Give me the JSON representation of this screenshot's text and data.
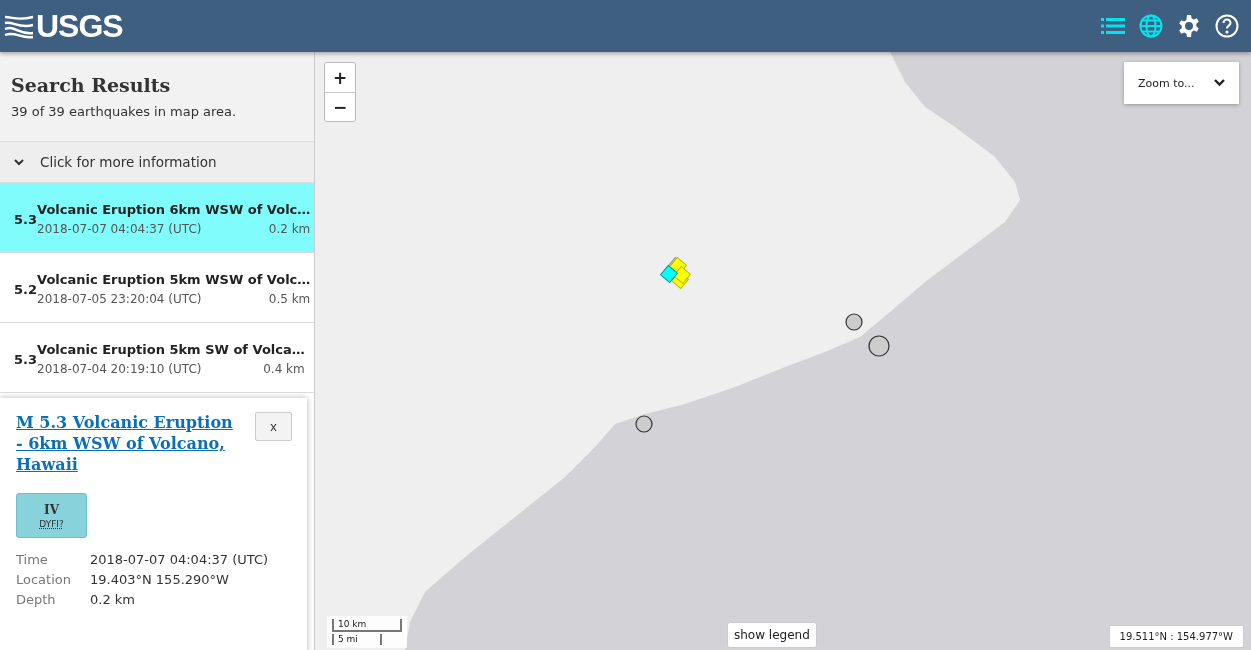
{
  "header": {
    "logo": "USGS",
    "tools": [
      {
        "kind": "list",
        "selected": true
      },
      {
        "kind": "map",
        "selected": true
      },
      {
        "kind": "settings",
        "selected": false
      },
      {
        "kind": "help",
        "selected": false
      }
    ]
  },
  "search_results": {
    "title": "Search Results",
    "summary": "39 of 39 earthquakes in map area.",
    "info_toggle": "Click for more information"
  },
  "events": [
    {
      "magnitude": "5.3",
      "title": "Volcanic Eruption 6km WSW of Volc…",
      "time": "2018-07-07 04:04:37 (UTC)",
      "depth": "0.2 km",
      "selected": true
    },
    {
      "magnitude": "5.2",
      "title": "Volcanic Eruption 5km WSW of Volc…",
      "time": "2018-07-05 23:20:04 (UTC)",
      "depth": "0.5 km",
      "selected": false
    },
    {
      "magnitude": "5.3",
      "title": "Volcanic Eruption 5km SW of Volca…",
      "time": "2018-07-04 20:19:10 (UTC)",
      "depth": "0.4 km",
      "selected": false
    }
  ],
  "popup": {
    "title": "M 5.3 Volcanic Eruption - 6km WSW of Volcano, Hawaii",
    "close": "x",
    "intensity": "IV",
    "dyfi": "DYFI?",
    "details": [
      {
        "label": "Time",
        "value": "2018-07-07 04:04:37 (UTC)"
      },
      {
        "label": "Location",
        "value": "19.403°N 155.290°W"
      },
      {
        "label": "Depth",
        "value": "0.2 km"
      }
    ]
  },
  "map": {
    "zoom_in": "+",
    "zoom_out": "−",
    "zoom_to": "Zoom to...",
    "scale": [
      "10 km",
      "5 mi"
    ],
    "legend_button": "show legend",
    "coordinates": "19.511°N : 154.977°W"
  }
}
